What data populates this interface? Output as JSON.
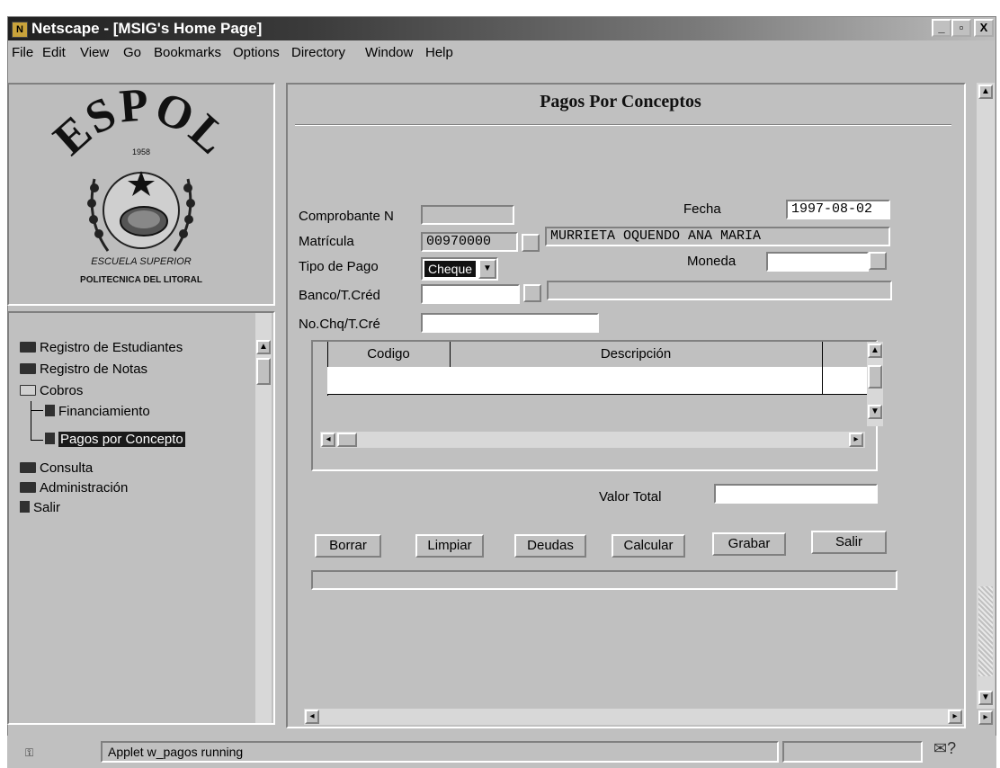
{
  "window": {
    "title": "Netscape - [MSIG's Home Page]",
    "controls": {
      "minimize": "_",
      "maximize": "▫",
      "close": "X"
    }
  },
  "menu": [
    "File",
    "Edit",
    "View",
    "Go",
    "Bookmarks",
    "Options",
    "Directory",
    "Window",
    "Help"
  ],
  "logo": {
    "name": "ESPOL",
    "year": "1958",
    "motto_lines": [
      "ESCUELA SUPERIOR",
      "POLITECNICA DEL LITORAL"
    ]
  },
  "sidebar": {
    "items": [
      {
        "label": "Registro de Estudiantes",
        "icon": "folder-icon"
      },
      {
        "label": "Registro de Notas",
        "icon": "folder-icon"
      },
      {
        "label": "Cobros",
        "icon": "folder-open-icon"
      },
      {
        "label": "Financiamiento",
        "icon": "document-icon"
      },
      {
        "label": "Pagos por Concepto",
        "icon": "document-icon",
        "selected": true
      },
      {
        "label": "Consulta",
        "icon": "folder-icon"
      },
      {
        "label": "Administración",
        "icon": "folder-icon"
      },
      {
        "label": "Salir",
        "icon": "document-icon"
      }
    ]
  },
  "form": {
    "title": "Pagos Por Conceptos",
    "comprobante_label": "Comprobante N",
    "comprobante_value": "",
    "fecha_label": "Fecha",
    "fecha_value": "1997-08-02",
    "matricula_label": "Matrícula",
    "matricula_value": "00970000",
    "nombre_value": "MURRIETA OQUENDO ANA MARIA",
    "tipo_pago_label": "Tipo de Pago",
    "tipo_pago_value": "Cheque",
    "moneda_label": "Moneda",
    "moneda_value": "",
    "banco_label": "Banco/T.Créd",
    "banco_value": "",
    "banco_desc_value": "",
    "nocheque_label": "No.Chq/T.Cré",
    "nocheque_value": "",
    "table": {
      "columns": [
        "Codigo",
        "Descripción"
      ]
    },
    "valor_total_label": "Valor Total",
    "valor_total_value": "",
    "buttons": [
      "Borrar",
      "Limpiar",
      "Deudas",
      "Calcular",
      "Grabar",
      "Salir"
    ]
  },
  "status": {
    "text": "Applet w_pagos running"
  }
}
